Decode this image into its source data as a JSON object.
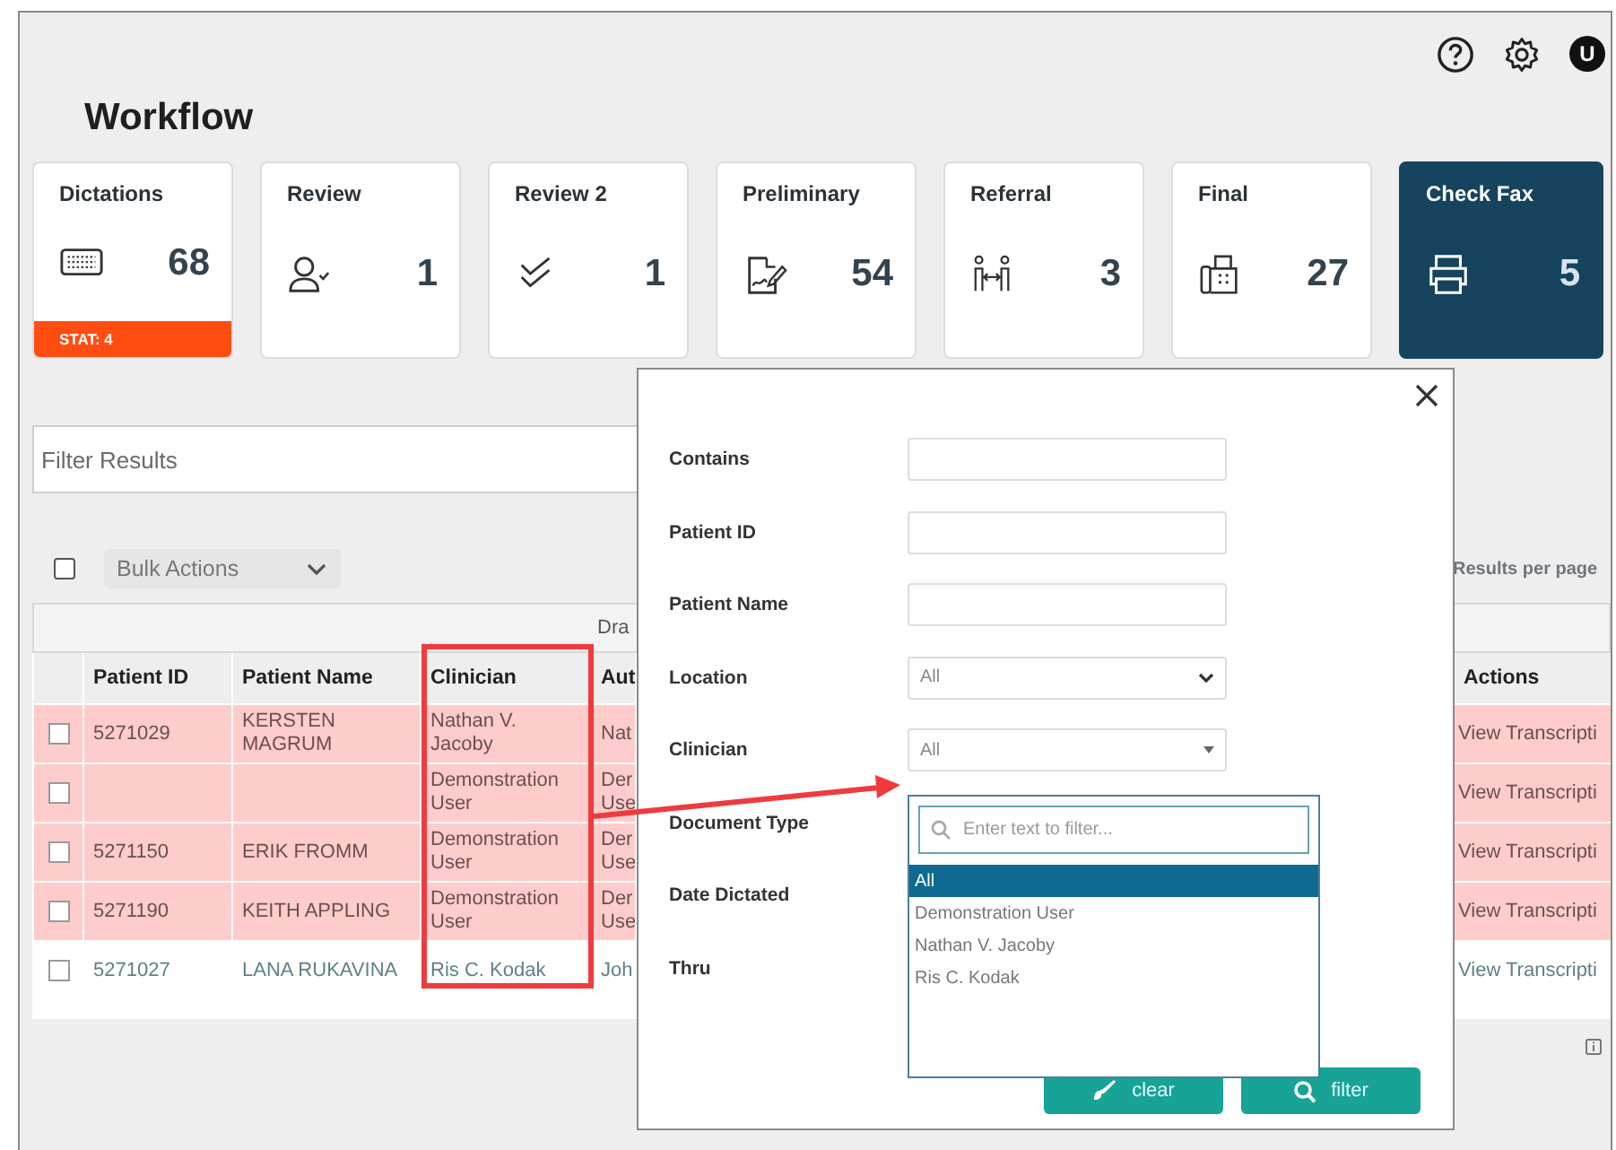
{
  "user_avatar": "U",
  "page_title": "Workflow",
  "cards": [
    {
      "title": "Dictations",
      "count": "68",
      "kind": "keyboard",
      "badge": "STAT: 4",
      "selected": false
    },
    {
      "title": "Review",
      "count": "1",
      "kind": "person-check",
      "selected": false
    },
    {
      "title": "Review 2",
      "count": "1",
      "kind": "double-check",
      "selected": false
    },
    {
      "title": "Preliminary",
      "count": "54",
      "kind": "document-sign",
      "selected": false
    },
    {
      "title": "Referral",
      "count": "3",
      "kind": "people-exchange",
      "selected": false
    },
    {
      "title": "Final",
      "count": "27",
      "kind": "fax",
      "selected": false
    },
    {
      "title": "Check Fax",
      "count": "5",
      "kind": "printer",
      "selected": true
    }
  ],
  "filter_field": {
    "placeholder": "Filter Results"
  },
  "bulk_actions": {
    "label": "Bulk Actions",
    "checked": false
  },
  "results_per_page": "Results per page",
  "table": {
    "group_header": "Dra",
    "columns": [
      "Patient ID",
      "Patient Name",
      "Clinician",
      "Aut",
      "Actions"
    ],
    "rows": [
      {
        "checked": false,
        "highlighted": true,
        "cells": [
          "5271029",
          "KERSTEN MAGRUM",
          "Nathan V. Jacoby",
          "Nat",
          "View Transcripti"
        ]
      },
      {
        "checked": false,
        "highlighted": true,
        "cells": [
          null,
          null,
          "Demonstration User",
          "Der Use",
          "View Transcripti"
        ]
      },
      {
        "checked": false,
        "highlighted": true,
        "cells": [
          "5271150",
          "ERIK FROMM",
          "Demonstration User",
          "Der Use",
          "View Transcripti"
        ]
      },
      {
        "checked": false,
        "highlighted": true,
        "cells": [
          "5271190",
          "KEITH APPLING",
          "Demonstration User",
          "Der Use",
          "View Transcripti"
        ]
      },
      {
        "checked": false,
        "highlighted": false,
        "cells": [
          "5271027",
          "LANA RUKAVINA",
          "Ris C. Kodak",
          "Joh",
          "View Transcripti"
        ]
      }
    ]
  },
  "filter_dialog": {
    "fields": [
      {
        "label": "Contains",
        "kind": "text"
      },
      {
        "label": "Patient ID",
        "kind": "text"
      },
      {
        "label": "Patient Name",
        "kind": "text"
      },
      {
        "label": "Location",
        "kind": "select",
        "value": "All"
      },
      {
        "label": "Clinician",
        "kind": "combo",
        "value": "All"
      },
      {
        "label": "Document Type",
        "kind": "label"
      },
      {
        "label": "Date Dictated",
        "kind": "label"
      },
      {
        "label": "Thru",
        "kind": "label"
      }
    ],
    "buttons": [
      {
        "label": "clear",
        "kind": "clear"
      },
      {
        "label": "filter",
        "kind": "filter"
      }
    ]
  },
  "clinician_dropdown": {
    "placeholder": "Enter text to filter...",
    "options": [
      {
        "label": "All",
        "selected": true
      },
      {
        "label": "Demonstration User",
        "selected": false
      },
      {
        "label": "Nathan V. Jacoby",
        "selected": false
      },
      {
        "label": "Ris C. Kodak",
        "selected": false
      }
    ]
  }
}
